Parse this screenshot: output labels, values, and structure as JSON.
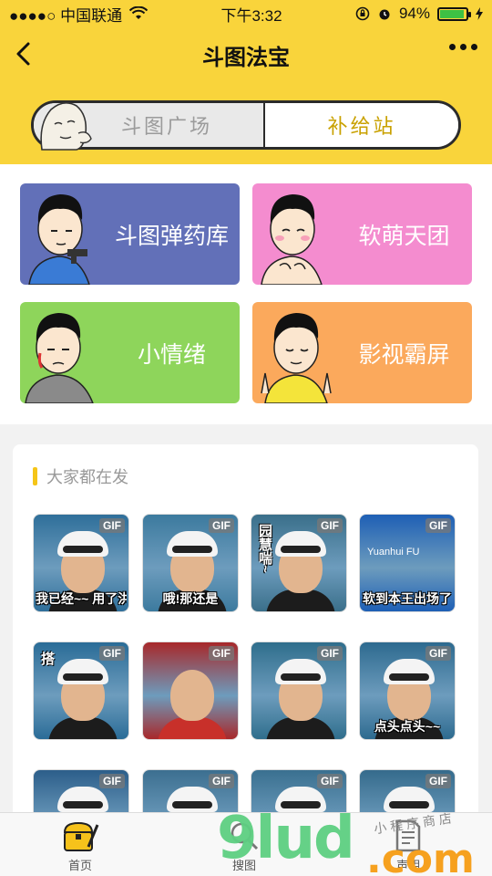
{
  "status_bar": {
    "carrier": "●●●●○ 中国联通",
    "time": "下午3:32",
    "battery_pct": "94%",
    "battery_level": 0.94
  },
  "nav": {
    "title": "斗图法宝"
  },
  "segments": {
    "left": "斗图广场",
    "right": "补给站",
    "active": "right"
  },
  "categories": [
    {
      "label": "斗图弹药库",
      "color": "#6270b8"
    },
    {
      "label": "软萌天团",
      "color": "#f48ccf"
    },
    {
      "label": "小情绪",
      "color": "#8ed55b"
    },
    {
      "label": "影视霸屏",
      "color": "#fba95c"
    }
  ],
  "trending": {
    "title": "大家都在发",
    "badge": "GIF",
    "items": [
      {
        "caption": "我已经~~ 用了洪荒之力啦!",
        "bg": "#2f6f9a"
      },
      {
        "caption": "哦!那还是",
        "bg": "#3c7a9e"
      },
      {
        "caption": "园慧喘~",
        "bg": "#3a6f8a",
        "vertical": true
      },
      {
        "caption": "软到本王出场了",
        "bg": "#1e5fb5",
        "scoreboard": "Yuanhui FU"
      },
      {
        "caption": "搭",
        "bg": "#2a6c97",
        "vertical": true
      },
      {
        "caption": "",
        "bg": "#a8282a"
      },
      {
        "caption": "",
        "bg": "#2f6e8c"
      },
      {
        "caption": "点头点头~~",
        "bg": "#2d6a8f"
      },
      {
        "caption": "",
        "bg": "#2c5e8a"
      },
      {
        "caption": "",
        "bg": "#3c6f90"
      },
      {
        "caption": "",
        "bg": "#3a7090"
      },
      {
        "caption": "",
        "bg": "#356b8c"
      }
    ]
  },
  "tabbar": {
    "home": "首页",
    "search": "搜图",
    "info": "声明"
  },
  "watermark": {
    "main": "9lud",
    "suffix": ".com",
    "small": "小程序商店"
  }
}
